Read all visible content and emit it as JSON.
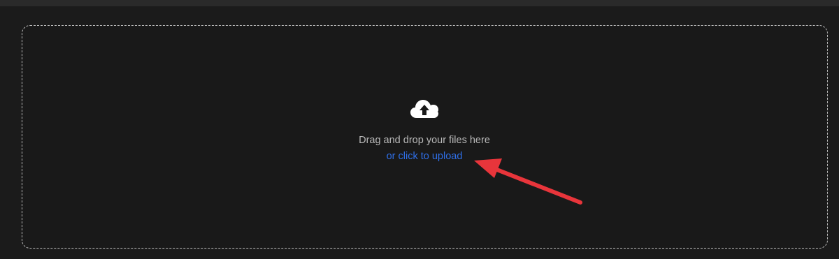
{
  "dropzone": {
    "prompt": "Drag and drop your files here",
    "link_text": "or click to upload",
    "icon": "cloud-upload-icon",
    "link_color": "#2f6fe8",
    "border_color": "#bdbdbd"
  },
  "annotation": {
    "icon": "red-arrow-icon",
    "color": "#e8353b"
  }
}
